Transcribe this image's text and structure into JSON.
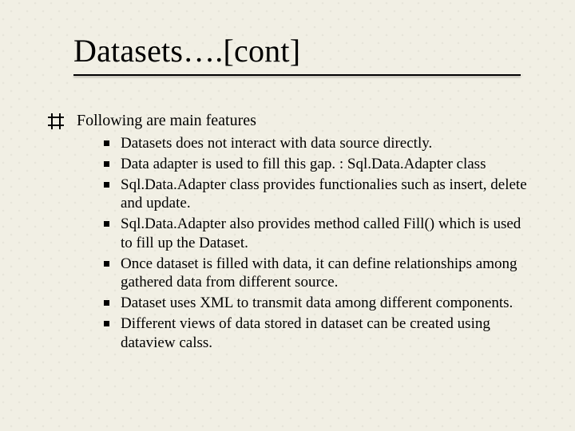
{
  "slide": {
    "title": "Datasets….[cont]",
    "level1": {
      "text": "Following are main features"
    },
    "bullets": [
      "Datasets does not interact with data source directly.",
      "Data adapter is used to fill this gap. : Sql.Data.Adapter class",
      "Sql.Data.Adapter class provides functionalies such as insert, delete and update.",
      "Sql.Data.Adapter also provides method called Fill() which is used to fill up the Dataset.",
      "Once dataset is filled with data, it can define relationships among gathered data from different source.",
      "Dataset uses XML to transmit data among different components.",
      "Different views of data stored in dataset can be created using dataview calss."
    ]
  }
}
